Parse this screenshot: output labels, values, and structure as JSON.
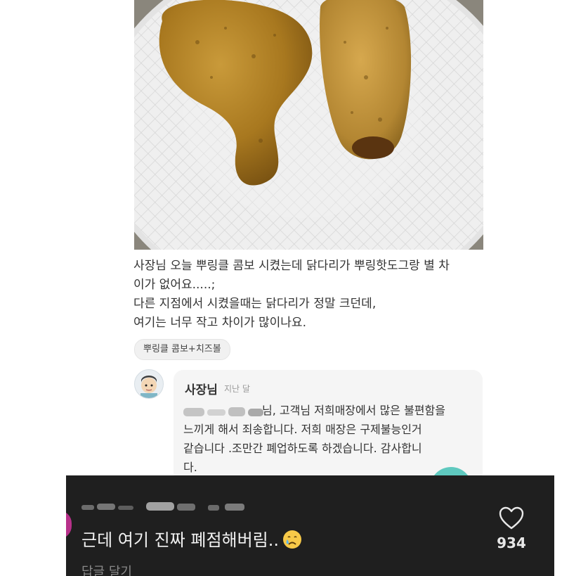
{
  "review": {
    "menu_item_image_alt": "",
    "text_lines": [
      "사장님 오늘 뿌링클 콤보 시켰는데 닭다리가 뿌링핫도그랑 별 차",
      "이가 없어요.....;",
      "다른 지점에서 시켰을때는 닭다리가 정말 크던데,",
      "여기는 너무 작고 차이가 많이나요."
    ],
    "menu_tag": "뿌링클 콤보+치즈볼"
  },
  "owner_reply": {
    "author": "사장님",
    "date": "지난 달",
    "text_line_1_rest": "님, 고객님 저희매장에서 많은 불편함을",
    "text_line_2": "느끼게 해서 죄송합니다. 저희 매장은 구제불능인거",
    "text_line_3": "같습니다 .조만간 폐업하도록 하겠습니다. 감사합니",
    "text_line_4": "다."
  },
  "comment": {
    "text": "근데 여기 진짜 폐점해버림..",
    "emoji_icon": "crying-face-icon",
    "like_count": "934",
    "reply_label": "답글 달기"
  },
  "colors": {
    "comment_bg": "#1f1f1f",
    "reply_bg": "#f5f5f5",
    "accent_teal": "#5fc9bf",
    "avatar_edge": "#b7318a"
  }
}
